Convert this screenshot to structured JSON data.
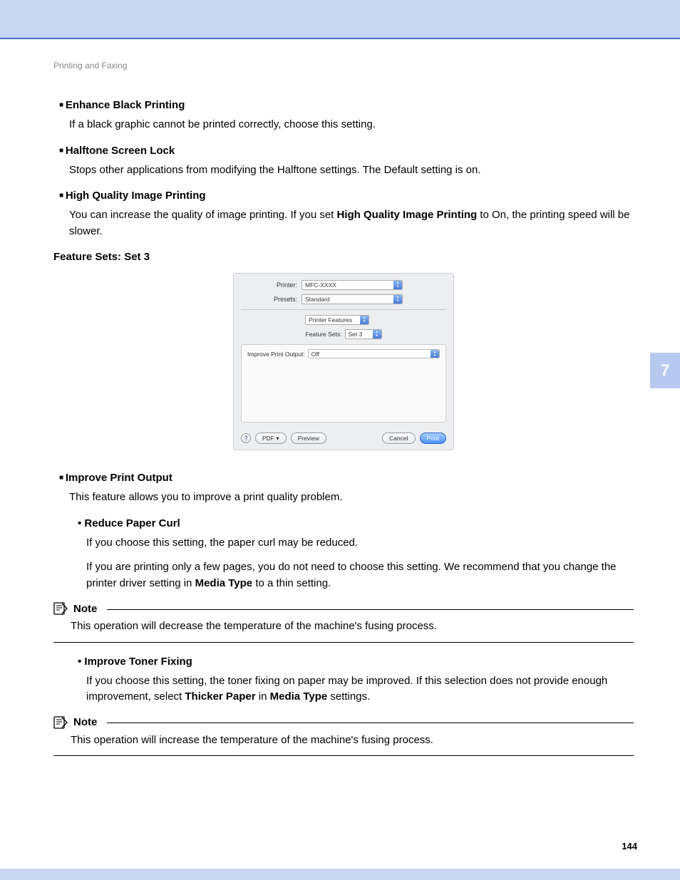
{
  "breadcrumb": "Printing and Faxing",
  "items": [
    {
      "title": "Enhance Black Printing",
      "body": "If a black graphic cannot be printed correctly, choose this setting."
    },
    {
      "title": "Halftone Screen Lock",
      "body": "Stops other applications from modifying the Halftone settings. The Default setting is on."
    },
    {
      "title": "High Quality Image Printing",
      "body_pre": "You can increase the quality of image printing. If you set ",
      "body_bold": "High Quality Image Printing",
      "body_post": " to On, the printing speed will be slower."
    }
  ],
  "feature_sets_label": "Feature Sets: Set 3",
  "dialog": {
    "printer_label": "Printer:",
    "printer_value": "MFC-XXXX",
    "presets_label": "Presets:",
    "presets_value": "Standard",
    "pane_value": "Printer Features",
    "feature_sets_label": "Feature Sets:",
    "feature_sets_value": "Set 3",
    "improve_label": "Improve Print Output:",
    "improve_value": "Off",
    "help": "?",
    "pdf": "PDF ▾",
    "preview": "Preview",
    "cancel": "Cancel",
    "print": "Print"
  },
  "improve_item": {
    "title": "Improve Print Output",
    "body": "This feature allows you to improve a print quality problem."
  },
  "sub1": {
    "title": "Reduce Paper Curl",
    "body1": "If you choose this setting, the paper curl may be reduced.",
    "body2_pre": "If you are printing only a few pages, you do not need to choose this setting. We recommend that you change the printer driver setting in ",
    "body2_bold": "Media Type",
    "body2_post": " to a thin setting."
  },
  "note1": {
    "label": "Note",
    "body": "This operation will decrease the temperature of the machine's fusing process."
  },
  "sub2": {
    "title": "Improve Toner Fixing",
    "body_pre": "If you choose this setting, the toner fixing on paper may be improved. If this selection does not provide enough improvement, select ",
    "body_bold1": "Thicker Paper",
    "body_mid": " in ",
    "body_bold2": "Media Type",
    "body_post": " settings."
  },
  "note2": {
    "label": "Note",
    "body": "This operation will increase the temperature of the machine's fusing process."
  },
  "chapter": "7",
  "page_number": "144"
}
